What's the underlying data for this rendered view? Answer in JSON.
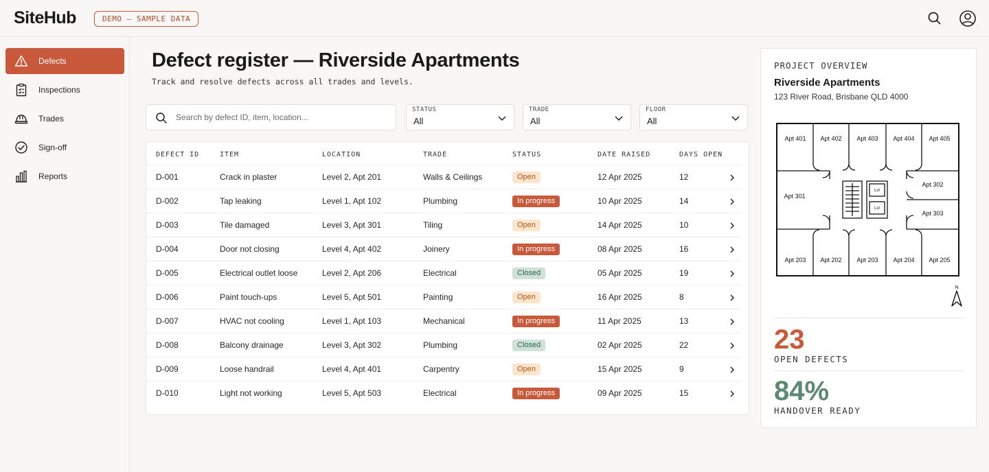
{
  "header": {
    "logo": "SiteHub",
    "demo_badge": "DEMO — SAMPLE DATA",
    "icons": [
      "search-icon",
      "user-icon"
    ]
  },
  "sidebar": {
    "items": [
      {
        "label": "Defects",
        "icon": "warning-icon",
        "active": true
      },
      {
        "label": "Inspections",
        "icon": "clipboard-icon",
        "active": false
      },
      {
        "label": "Trades",
        "icon": "hardhat-icon",
        "active": false
      },
      {
        "label": "Sign-off",
        "icon": "check-circle-icon",
        "active": false
      },
      {
        "label": "Reports",
        "icon": "bar-chart-icon",
        "active": false
      }
    ]
  },
  "main": {
    "title": "Defect register — Riverside Apartments",
    "subtitle": "Track and resolve defects across all trades and levels.",
    "search": {
      "placeholder": "Search by defect ID, item, location...",
      "value": ""
    },
    "filters": [
      {
        "label": "STATUS",
        "value": "All"
      },
      {
        "label": "TRADE",
        "value": "All"
      },
      {
        "label": "FLOOR",
        "value": "All"
      }
    ],
    "table": {
      "columns": [
        "DEFECT ID",
        "ITEM",
        "LOCATION",
        "TRADE",
        "STATUS",
        "DATE RAISED",
        "DAYS OPEN"
      ],
      "rows": [
        {
          "id": "D-001",
          "item": "Crack in plaster",
          "location": "Level 2, Apt 201",
          "trade": "Walls & Ceilings",
          "status": "Open",
          "date": "12 Apr 2025",
          "days": "12"
        },
        {
          "id": "D-002",
          "item": "Tap leaking",
          "location": "Level 1, Apt 102",
          "trade": "Plumbing",
          "status": "In progress",
          "date": "10 Apr 2025",
          "days": "14"
        },
        {
          "id": "D-003",
          "item": "Tile damaged",
          "location": "Level 3, Apt 301",
          "trade": "Tiling",
          "status": "Open",
          "date": "14 Apr 2025",
          "days": "10"
        },
        {
          "id": "D-004",
          "item": "Door not closing",
          "location": "Level 4, Apt 402",
          "trade": "Joinery",
          "status": "In progress",
          "date": "08 Apr 2025",
          "days": "16"
        },
        {
          "id": "D-005",
          "item": "Electrical outlet loose",
          "location": "Level 2, Apt 206",
          "trade": "Electrical",
          "status": "Closed",
          "date": "05 Apr 2025",
          "days": "19"
        },
        {
          "id": "D-006",
          "item": "Paint touch-ups",
          "location": "Level 5, Apt 501",
          "trade": "Painting",
          "status": "Open",
          "date": "16 Apr 2025",
          "days": "8"
        },
        {
          "id": "D-007",
          "item": "HVAC not cooling",
          "location": "Level 1, Apt 103",
          "trade": "Mechanical",
          "status": "In progress",
          "date": "11 Apr 2025",
          "days": "13"
        },
        {
          "id": "D-008",
          "item": "Balcony drainage",
          "location": "Level 3, Apt 302",
          "trade": "Plumbing",
          "status": "Closed",
          "date": "02 Apr 2025",
          "days": "22"
        },
        {
          "id": "D-009",
          "item": "Loose handrail",
          "location": "Level 4, Apt 401",
          "trade": "Carpentry",
          "status": "Open",
          "date": "15 Apr 2025",
          "days": "9"
        },
        {
          "id": "D-010",
          "item": "Light not working",
          "location": "Level 5, Apt 503",
          "trade": "Electrical",
          "status": "In progress",
          "date": "09 Apr 2025",
          "days": "15"
        }
      ]
    }
  },
  "overview": {
    "label": "PROJECT OVERVIEW",
    "project_name": "Riverside Apartments",
    "address": "123 River Road, Brisbane QLD 4000",
    "floor_plan": {
      "top_units": [
        "Apt 401",
        "Apt 402",
        "Apt 403",
        "Apt 404",
        "Apt 405"
      ],
      "left_unit": "Apt 301",
      "right_units": [
        "Apt 302",
        "Apt 303"
      ],
      "bottom_units": [
        "Apt 203",
        "Apt 202",
        "Apt 203",
        "Apt 204",
        "Apt 205"
      ],
      "lift_labels": [
        "Lvl",
        "Lvl"
      ],
      "north_label": "N"
    },
    "stats": [
      {
        "value": "23",
        "label": "OPEN DEFECTS",
        "color": "#c8593a"
      },
      {
        "value": "84%",
        "label": "HANDOVER READY",
        "color": "#5b8a70"
      }
    ]
  },
  "colors": {
    "accent": "#c8593a",
    "open_bg": "#fde5cc",
    "open_fg": "#b1561d",
    "closed_bg": "#cfe2d7",
    "closed_fg": "#2f6149",
    "ready": "#5b8a70"
  }
}
